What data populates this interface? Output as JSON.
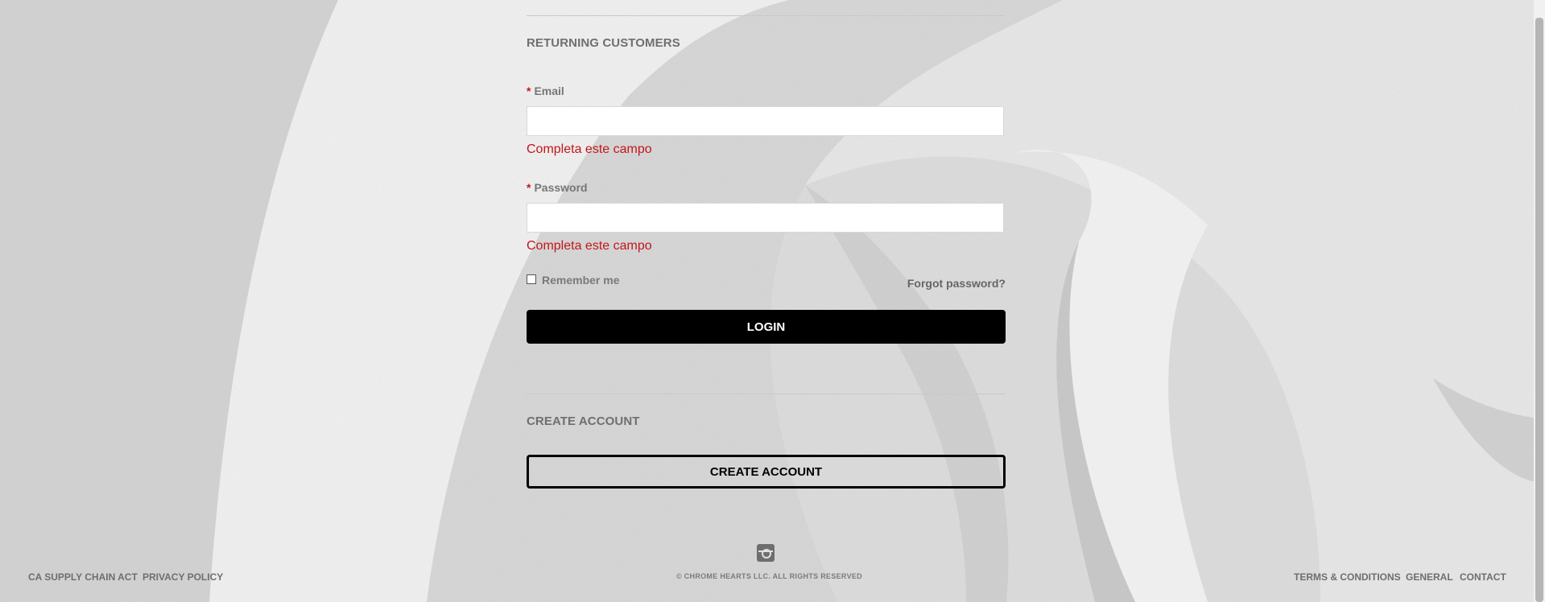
{
  "login": {
    "section_title": "RETURNING CUSTOMERS",
    "required_marker": "*",
    "email_label": "Email",
    "email_value": "",
    "email_error": "Completa este campo",
    "password_label": "Password",
    "password_value": "",
    "password_error": "Completa este campo",
    "remember_label": "Remember me",
    "remember_checked": false,
    "forgot_label": "Forgot password?",
    "login_button": "LOGIN"
  },
  "create": {
    "section_title": "CREATE ACCOUNT",
    "button": "CREATE ACCOUNT"
  },
  "footer": {
    "left_links": [
      "CA SUPPLY CHAIN ACT",
      "PRIVACY POLICY"
    ],
    "copyright": "© CHROME HEARTS LLC. ALL RIGHTS RESERVED",
    "social_icon": "instagram-icon",
    "right_links": [
      "TERMS & CONDITIONS",
      "GENERAL",
      "CONTACT"
    ]
  },
  "colors": {
    "error": "#c4161c",
    "button_bg": "#000000",
    "button_text": "#ffffff"
  }
}
